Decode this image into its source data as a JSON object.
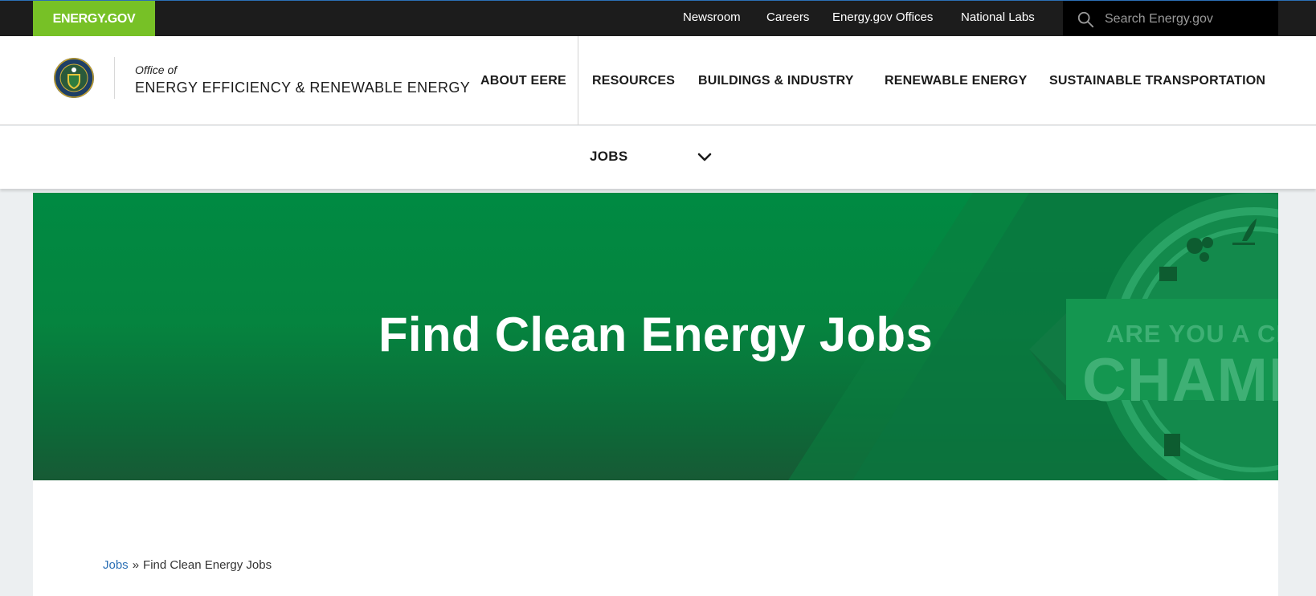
{
  "topbar": {
    "brand": "ENERGY.GOV",
    "links": [
      "Newsroom",
      "Careers",
      "Energy.gov Offices",
      "National Labs"
    ],
    "search_placeholder": "Search Energy.gov"
  },
  "header": {
    "office_prefix": "Office of",
    "office_name": "ENERGY EFFICIENCY & RENEWABLE ENERGY",
    "nav": [
      "ABOUT EERE",
      "RESOURCES",
      "BUILDINGS & INDUSTRY",
      "RENEWABLE ENERGY",
      "SUSTAINABLE TRANSPORTATION"
    ]
  },
  "subnav": {
    "label": "JOBS"
  },
  "hero": {
    "title": "Find Clean Energy Jobs",
    "badge_line1": "ARE YOU A CL",
    "badge_line2": "CHAMP"
  },
  "breadcrumb": {
    "link": "Jobs",
    "separator": "»",
    "current": "Find Clean Energy Jobs"
  },
  "colors": {
    "brand_green": "#77c126",
    "hero_green": "#008a42",
    "link_blue": "#2b6fb5",
    "topbar_bg": "#1c1c1c"
  }
}
